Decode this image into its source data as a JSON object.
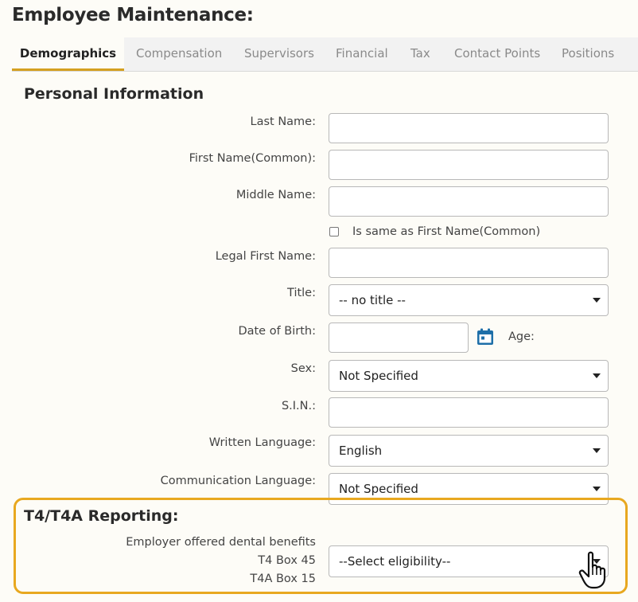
{
  "page_title": "Employee Maintenance:",
  "tabs": [
    {
      "label": "Demographics",
      "active": true
    },
    {
      "label": "Compensation",
      "active": false
    },
    {
      "label": "Supervisors",
      "active": false
    },
    {
      "label": "Financial",
      "active": false
    },
    {
      "label": "Tax",
      "active": false
    },
    {
      "label": "Contact Points",
      "active": false
    },
    {
      "label": "Positions",
      "active": false
    }
  ],
  "personal": {
    "heading": "Personal Information",
    "last_name_label": "Last Name:",
    "first_name_common_label": "First Name(Common):",
    "middle_name_label": "Middle Name:",
    "same_as_label": "Is same as First Name(Common)",
    "legal_first_name_label": "Legal First Name:",
    "title_label": "Title:",
    "title_value": "-- no title --",
    "dob_label": "Date of Birth:",
    "age_label": "Age:",
    "sex_label": "Sex:",
    "sex_value": "Not Specified",
    "sin_label": "S.I.N.:",
    "written_language_label": "Written Language:",
    "written_language_value": "English",
    "communication_language_label": "Communication Language:",
    "communication_language_value": "Not Specified"
  },
  "t4": {
    "heading": "T4/T4A Reporting:",
    "dental_label_line1": "Employer offered dental benefits",
    "dental_label_line2": "T4 Box 45",
    "dental_label_line3": "T4A Box 15",
    "eligibility_value": "--Select eligibility--"
  },
  "colors": {
    "accent": "#d4a020",
    "highlight_border": "#e8a820",
    "calendar_icon": "#1e6fa8"
  },
  "icons": {
    "calendar": "calendar-icon",
    "cursor": "hand-pointer-icon"
  }
}
